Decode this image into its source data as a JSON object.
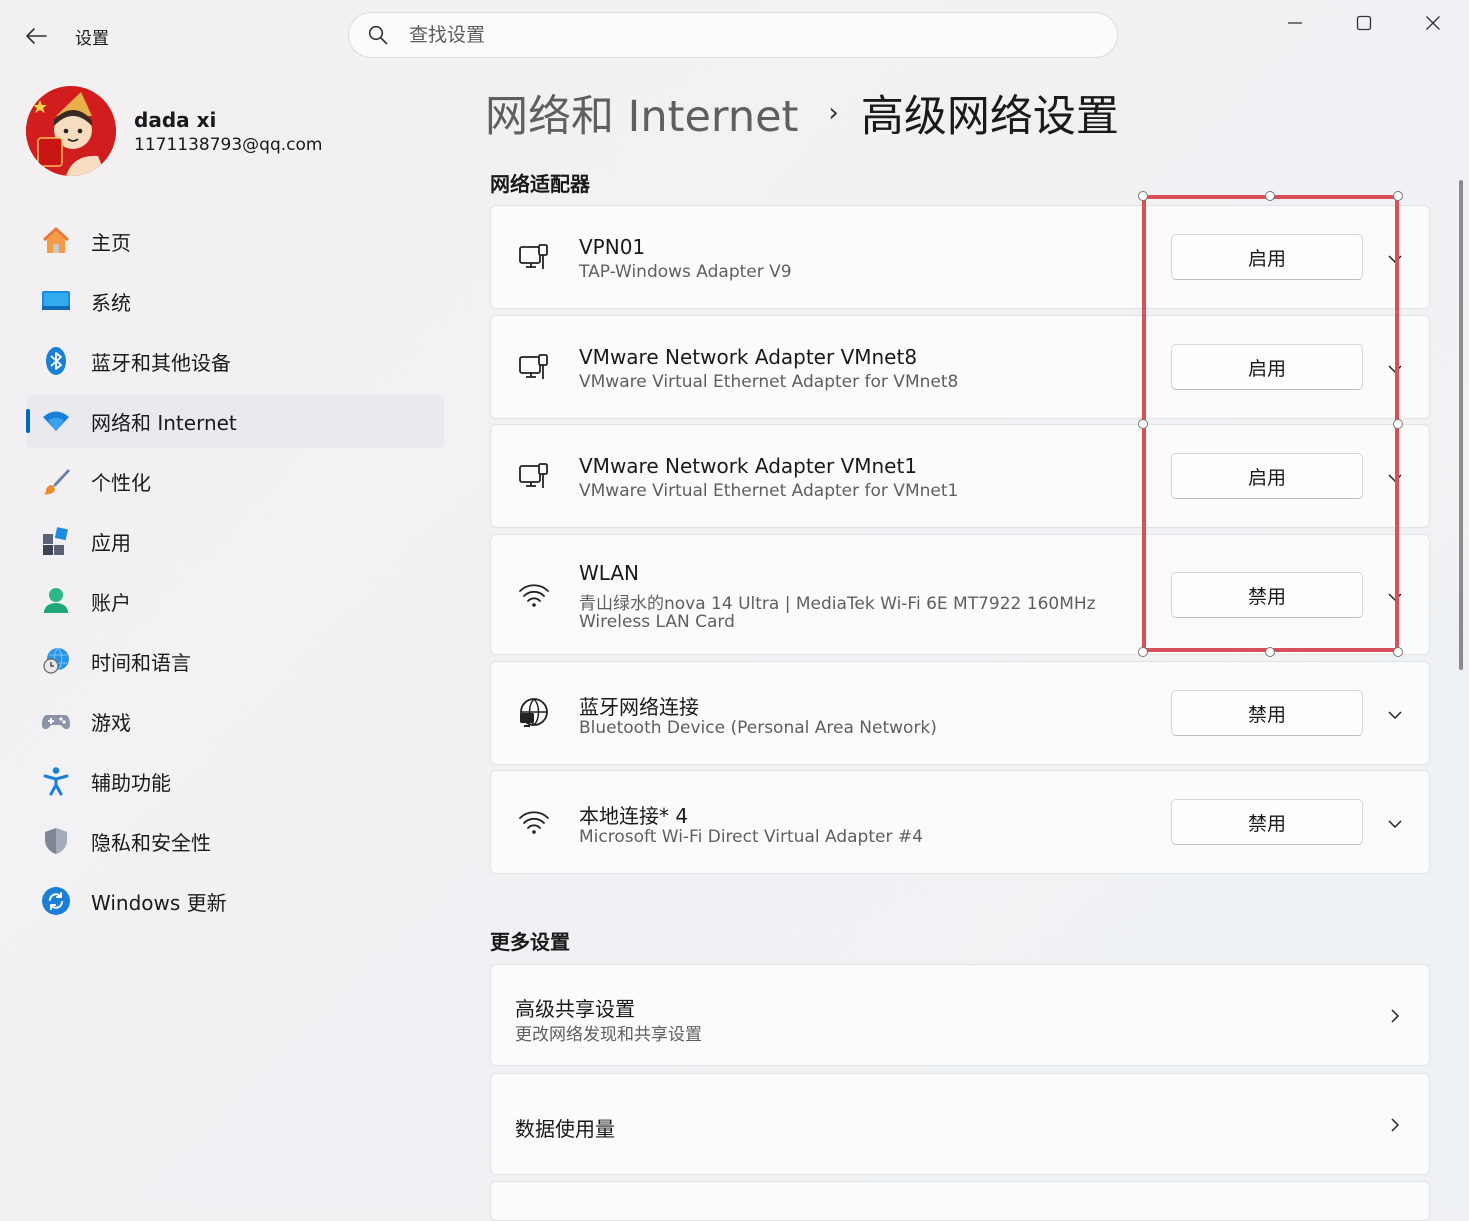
{
  "window": {
    "title": "设置",
    "search_placeholder": "查找设置"
  },
  "profile": {
    "name": "dada xi",
    "email": "1171138793@qq.com"
  },
  "nav": {
    "items": [
      {
        "label": "主页",
        "icon": "home-icon"
      },
      {
        "label": "系统",
        "icon": "system-icon"
      },
      {
        "label": "蓝牙和其他设备",
        "icon": "bluetooth-icon"
      },
      {
        "label": "网络和 Internet",
        "icon": "wifi-icon",
        "active": true
      },
      {
        "label": "个性化",
        "icon": "brush-icon"
      },
      {
        "label": "应用",
        "icon": "apps-icon"
      },
      {
        "label": "账户",
        "icon": "account-icon"
      },
      {
        "label": "时间和语言",
        "icon": "globe-clock-icon"
      },
      {
        "label": "游戏",
        "icon": "gamepad-icon"
      },
      {
        "label": "辅助功能",
        "icon": "accessibility-icon"
      },
      {
        "label": "隐私和安全性",
        "icon": "shield-icon"
      },
      {
        "label": "Windows 更新",
        "icon": "update-icon"
      }
    ]
  },
  "breadcrumb": {
    "parent": "网络和 Internet",
    "separator": "›",
    "current": "高级网络设置"
  },
  "adapters_section": {
    "title": "网络适配器",
    "items": [
      {
        "name": "VPN01",
        "desc": "TAP-Windows Adapter V9",
        "button": "启用",
        "icon": "ethernet-icon"
      },
      {
        "name": "VMware Network Adapter VMnet8",
        "desc": "VMware Virtual Ethernet Adapter for VMnet8",
        "button": "启用",
        "icon": "ethernet-icon"
      },
      {
        "name": "VMware Network Adapter VMnet1",
        "desc": "VMware Virtual Ethernet Adapter for VMnet1",
        "button": "启用",
        "icon": "ethernet-icon"
      },
      {
        "name": "WLAN",
        "desc": "青山绿水的nova 14 Ultra | MediaTek Wi-Fi 6E MT7922 160MHz",
        "desc2": "Wireless LAN Card",
        "button": "禁用",
        "icon": "wifi-icon"
      },
      {
        "name": "蓝牙网络连接",
        "desc": "Bluetooth Device (Personal Area Network)",
        "button": "禁用",
        "icon": "globe-network-icon"
      },
      {
        "name": "本地连接* 4",
        "desc": "Microsoft Wi-Fi Direct Virtual Adapter #4",
        "button": "禁用",
        "icon": "wifi-icon"
      }
    ]
  },
  "more_section": {
    "title": "更多设置",
    "items": [
      {
        "title": "高级共享设置",
        "desc": "更改网络发现和共享设置"
      },
      {
        "title": "数据使用量"
      }
    ]
  },
  "colors": {
    "accent": "#0067c0",
    "annotation": "#d9505a"
  }
}
